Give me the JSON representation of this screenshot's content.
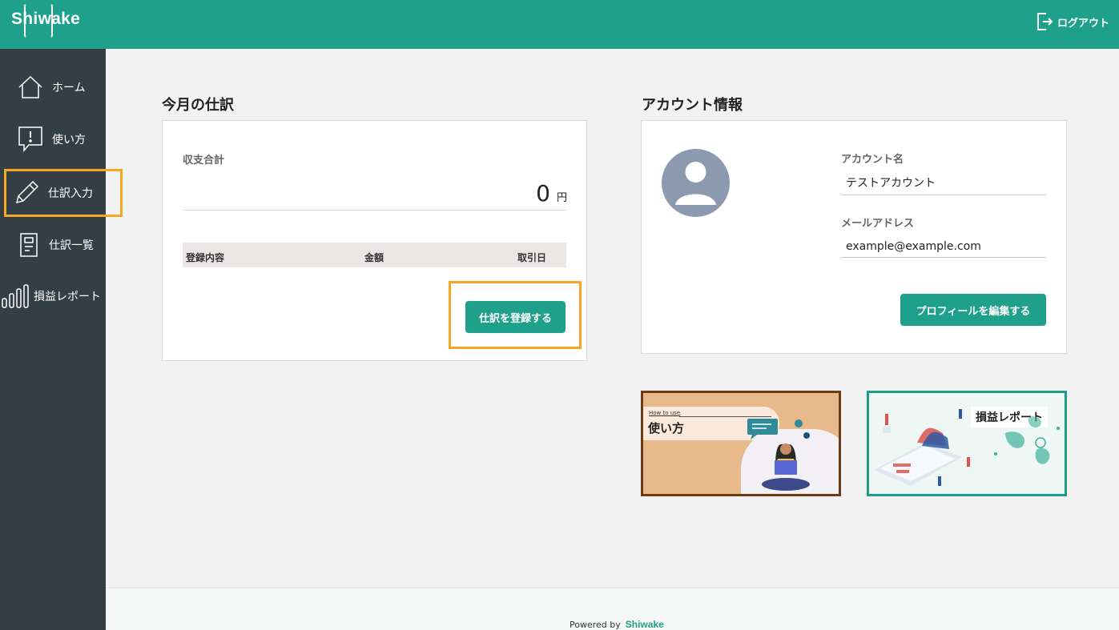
{
  "header": {
    "logo": "Shiwake",
    "logout_label": "ログアウト"
  },
  "sidebar": {
    "items": [
      {
        "label": "ホーム",
        "icon": "home-icon"
      },
      {
        "label": "使い方",
        "icon": "help-bubble-icon"
      },
      {
        "label": "仕訳入力",
        "icon": "pencil-icon"
      },
      {
        "label": "仕訳一覧",
        "icon": "list-doc-icon"
      },
      {
        "label": "損益レポート",
        "icon": "bar-chart-icon"
      }
    ]
  },
  "journal": {
    "title": "今月の仕訳",
    "total_label": "収支合計",
    "total_value": "0",
    "total_unit": "円",
    "columns": [
      "登録内容",
      "金額",
      "取引日"
    ],
    "register_button": "仕訳を登録する"
  },
  "account": {
    "title": "アカウント情報",
    "name_label": "アカウント名",
    "name_value": "テストアカウント",
    "email_label": "メールアドレス",
    "email_value": "example@example.com",
    "edit_button": "プロフィールを編集する"
  },
  "banners": {
    "howto_small": "How to use",
    "howto_title": "使い方",
    "report_title": "損益レポート"
  },
  "footer": {
    "powered_by": "Powered by",
    "logo": "Shiwake"
  },
  "colors": {
    "brand": "#1ea08a",
    "sidebar": "#333f44",
    "highlight": "#f5a623"
  }
}
